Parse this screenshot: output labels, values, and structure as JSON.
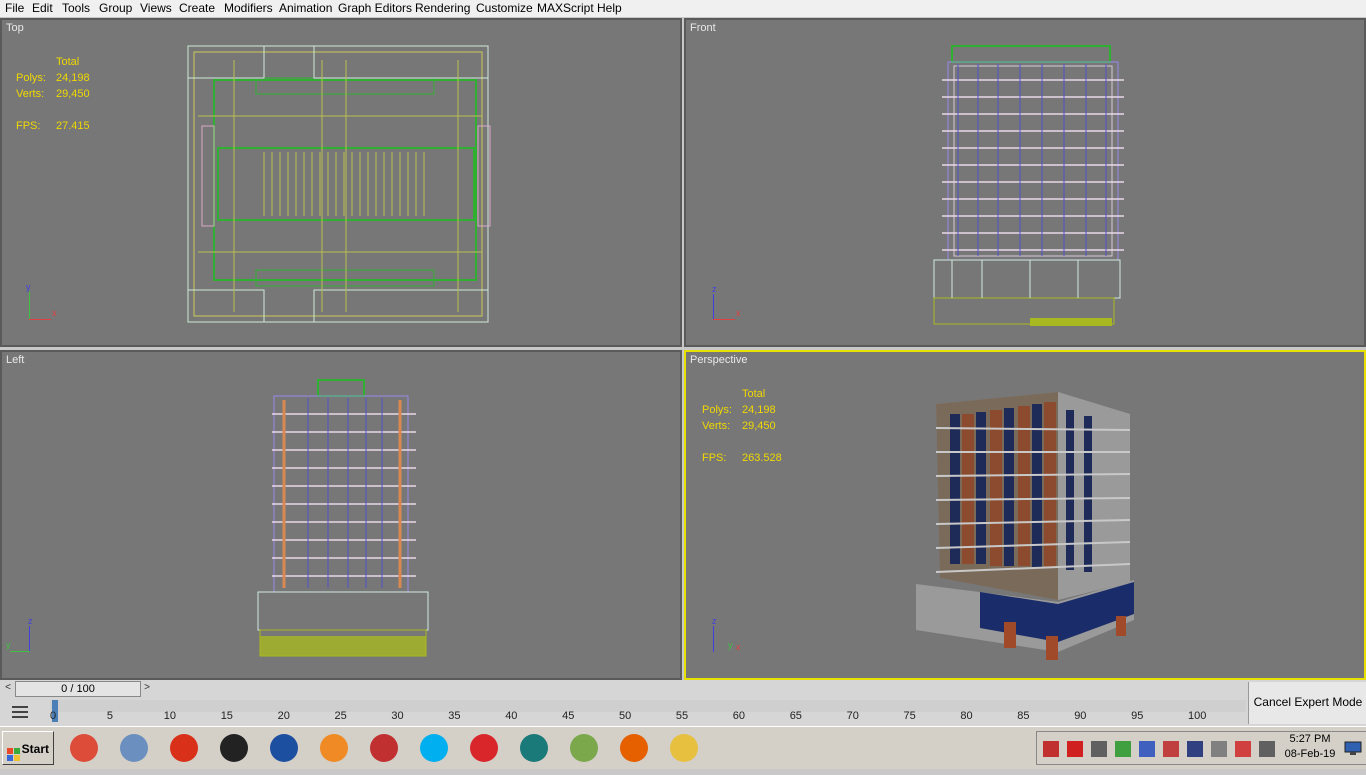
{
  "menu": [
    "File",
    "Edit",
    "Tools",
    "Group",
    "Views",
    "Create",
    "Modifiers",
    "Animation",
    "Graph Editors",
    "Rendering",
    "Customize",
    "MAXScript",
    "Help"
  ],
  "viewports": {
    "top": {
      "label": "Top",
      "stats": {
        "header": "Total",
        "polys_label": "Polys:",
        "polys": "24,198",
        "verts_label": "Verts:",
        "verts": "29,450",
        "fps_label": "FPS:",
        "fps": "27.415"
      }
    },
    "front": {
      "label": "Front"
    },
    "left": {
      "label": "Left"
    },
    "perspective": {
      "label": "Perspective",
      "stats": {
        "header": "Total",
        "polys_label": "Polys:",
        "polys": "24,198",
        "verts_label": "Verts:",
        "verts": "29,450",
        "fps_label": "FPS:",
        "fps": "263.528"
      }
    }
  },
  "axes": {
    "x": "x",
    "y": "y",
    "z": "z"
  },
  "timeline": {
    "frame": "0 / 100",
    "prev": "<",
    "next": ">",
    "ticks": [
      "0",
      "5",
      "10",
      "15",
      "20",
      "25",
      "30",
      "35",
      "40",
      "45",
      "50",
      "55",
      "60",
      "65",
      "70",
      "75",
      "80",
      "85",
      "90",
      "95",
      "100"
    ],
    "expert_button": "Cancel Expert Mode"
  },
  "taskbar": {
    "start": "Start",
    "apps": [
      {
        "icon": "chrome-icon",
        "color": "#dd4b39"
      },
      {
        "icon": "control-panel-icon",
        "color": "#6b8fbf"
      },
      {
        "icon": "sync-icon",
        "color": "#d9301a"
      },
      {
        "icon": "inkscape-icon",
        "color": "#222222"
      },
      {
        "icon": "globe-icon",
        "color": "#1d4fa0"
      },
      {
        "icon": "blender-icon",
        "color": "#f08a24"
      },
      {
        "icon": "snipping-tool-icon",
        "color": "#c03030"
      },
      {
        "icon": "skype-icon",
        "color": "#00aff0"
      },
      {
        "icon": "sketchup-icon",
        "color": "#d8262b"
      },
      {
        "icon": "3dsmax-icon",
        "color": "#1a7a7a"
      },
      {
        "icon": "notepad-icon",
        "color": "#7aa84a"
      },
      {
        "icon": "firefox-icon",
        "color": "#e66000"
      },
      {
        "icon": "file-explorer-icon",
        "color": "#e8c040"
      }
    ],
    "time": "5:27 PM",
    "date": "08-Feb-19"
  }
}
